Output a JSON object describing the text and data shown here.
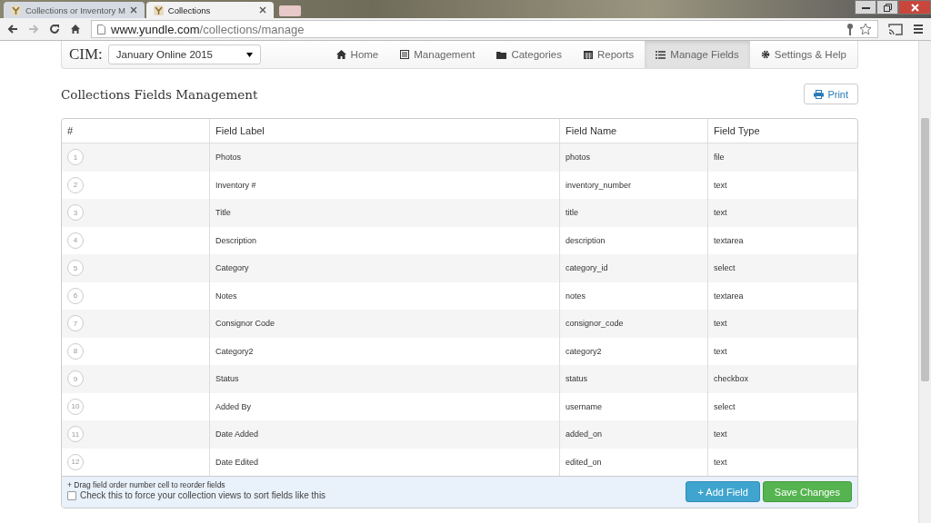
{
  "browser": {
    "tabs": [
      {
        "title": "Collections or Inventory M",
        "selected": false
      },
      {
        "title": "Collections",
        "selected": true
      }
    ],
    "url_host": "www.yundle.com",
    "url_path": "/collections/manage"
  },
  "navbar": {
    "brand": "CIM:",
    "collection_select": "January Online 2015",
    "items": [
      {
        "label": "Home",
        "selected": false
      },
      {
        "label": "Management",
        "selected": false
      },
      {
        "label": "Categories",
        "selected": false
      },
      {
        "label": "Reports",
        "selected": false
      },
      {
        "label": "Manage Fields",
        "selected": true
      },
      {
        "label": "Settings & Help",
        "selected": false
      }
    ]
  },
  "page_title": "Collections Fields Management",
  "print_button": "Print",
  "table": {
    "columns": [
      "#",
      "Field Label",
      "Field Name",
      "Field Type"
    ],
    "rows": [
      [
        "1",
        "Photos",
        "photos",
        "file"
      ],
      [
        "2",
        "Inventory #",
        "inventory_number",
        "text"
      ],
      [
        "3",
        "Title",
        "title",
        "text"
      ],
      [
        "4",
        "Description",
        "description",
        "textarea"
      ],
      [
        "5",
        "Category",
        "category_id",
        "select"
      ],
      [
        "6",
        "Notes",
        "notes",
        "textarea"
      ],
      [
        "7",
        "Consignor Code",
        "consignor_code",
        "text"
      ],
      [
        "8",
        "Category2",
        "category2",
        "text"
      ],
      [
        "9",
        "Status",
        "status",
        "checkbox"
      ],
      [
        "10",
        "Added By",
        "username",
        "select"
      ],
      [
        "11",
        "Date Added",
        "added_on",
        "text"
      ],
      [
        "12",
        "Date Edited",
        "edited_on",
        "text"
      ]
    ]
  },
  "footer": {
    "hint": "+ Drag field order number cell to reorder fields",
    "sort_checkbox": {
      "label": "Check this to force your collection views to sort fields like this",
      "checked": false
    },
    "buttons": [
      {
        "label": "+ Add Field",
        "kind": "info"
      },
      {
        "label": "Save Changes",
        "kind": "success"
      }
    ]
  }
}
